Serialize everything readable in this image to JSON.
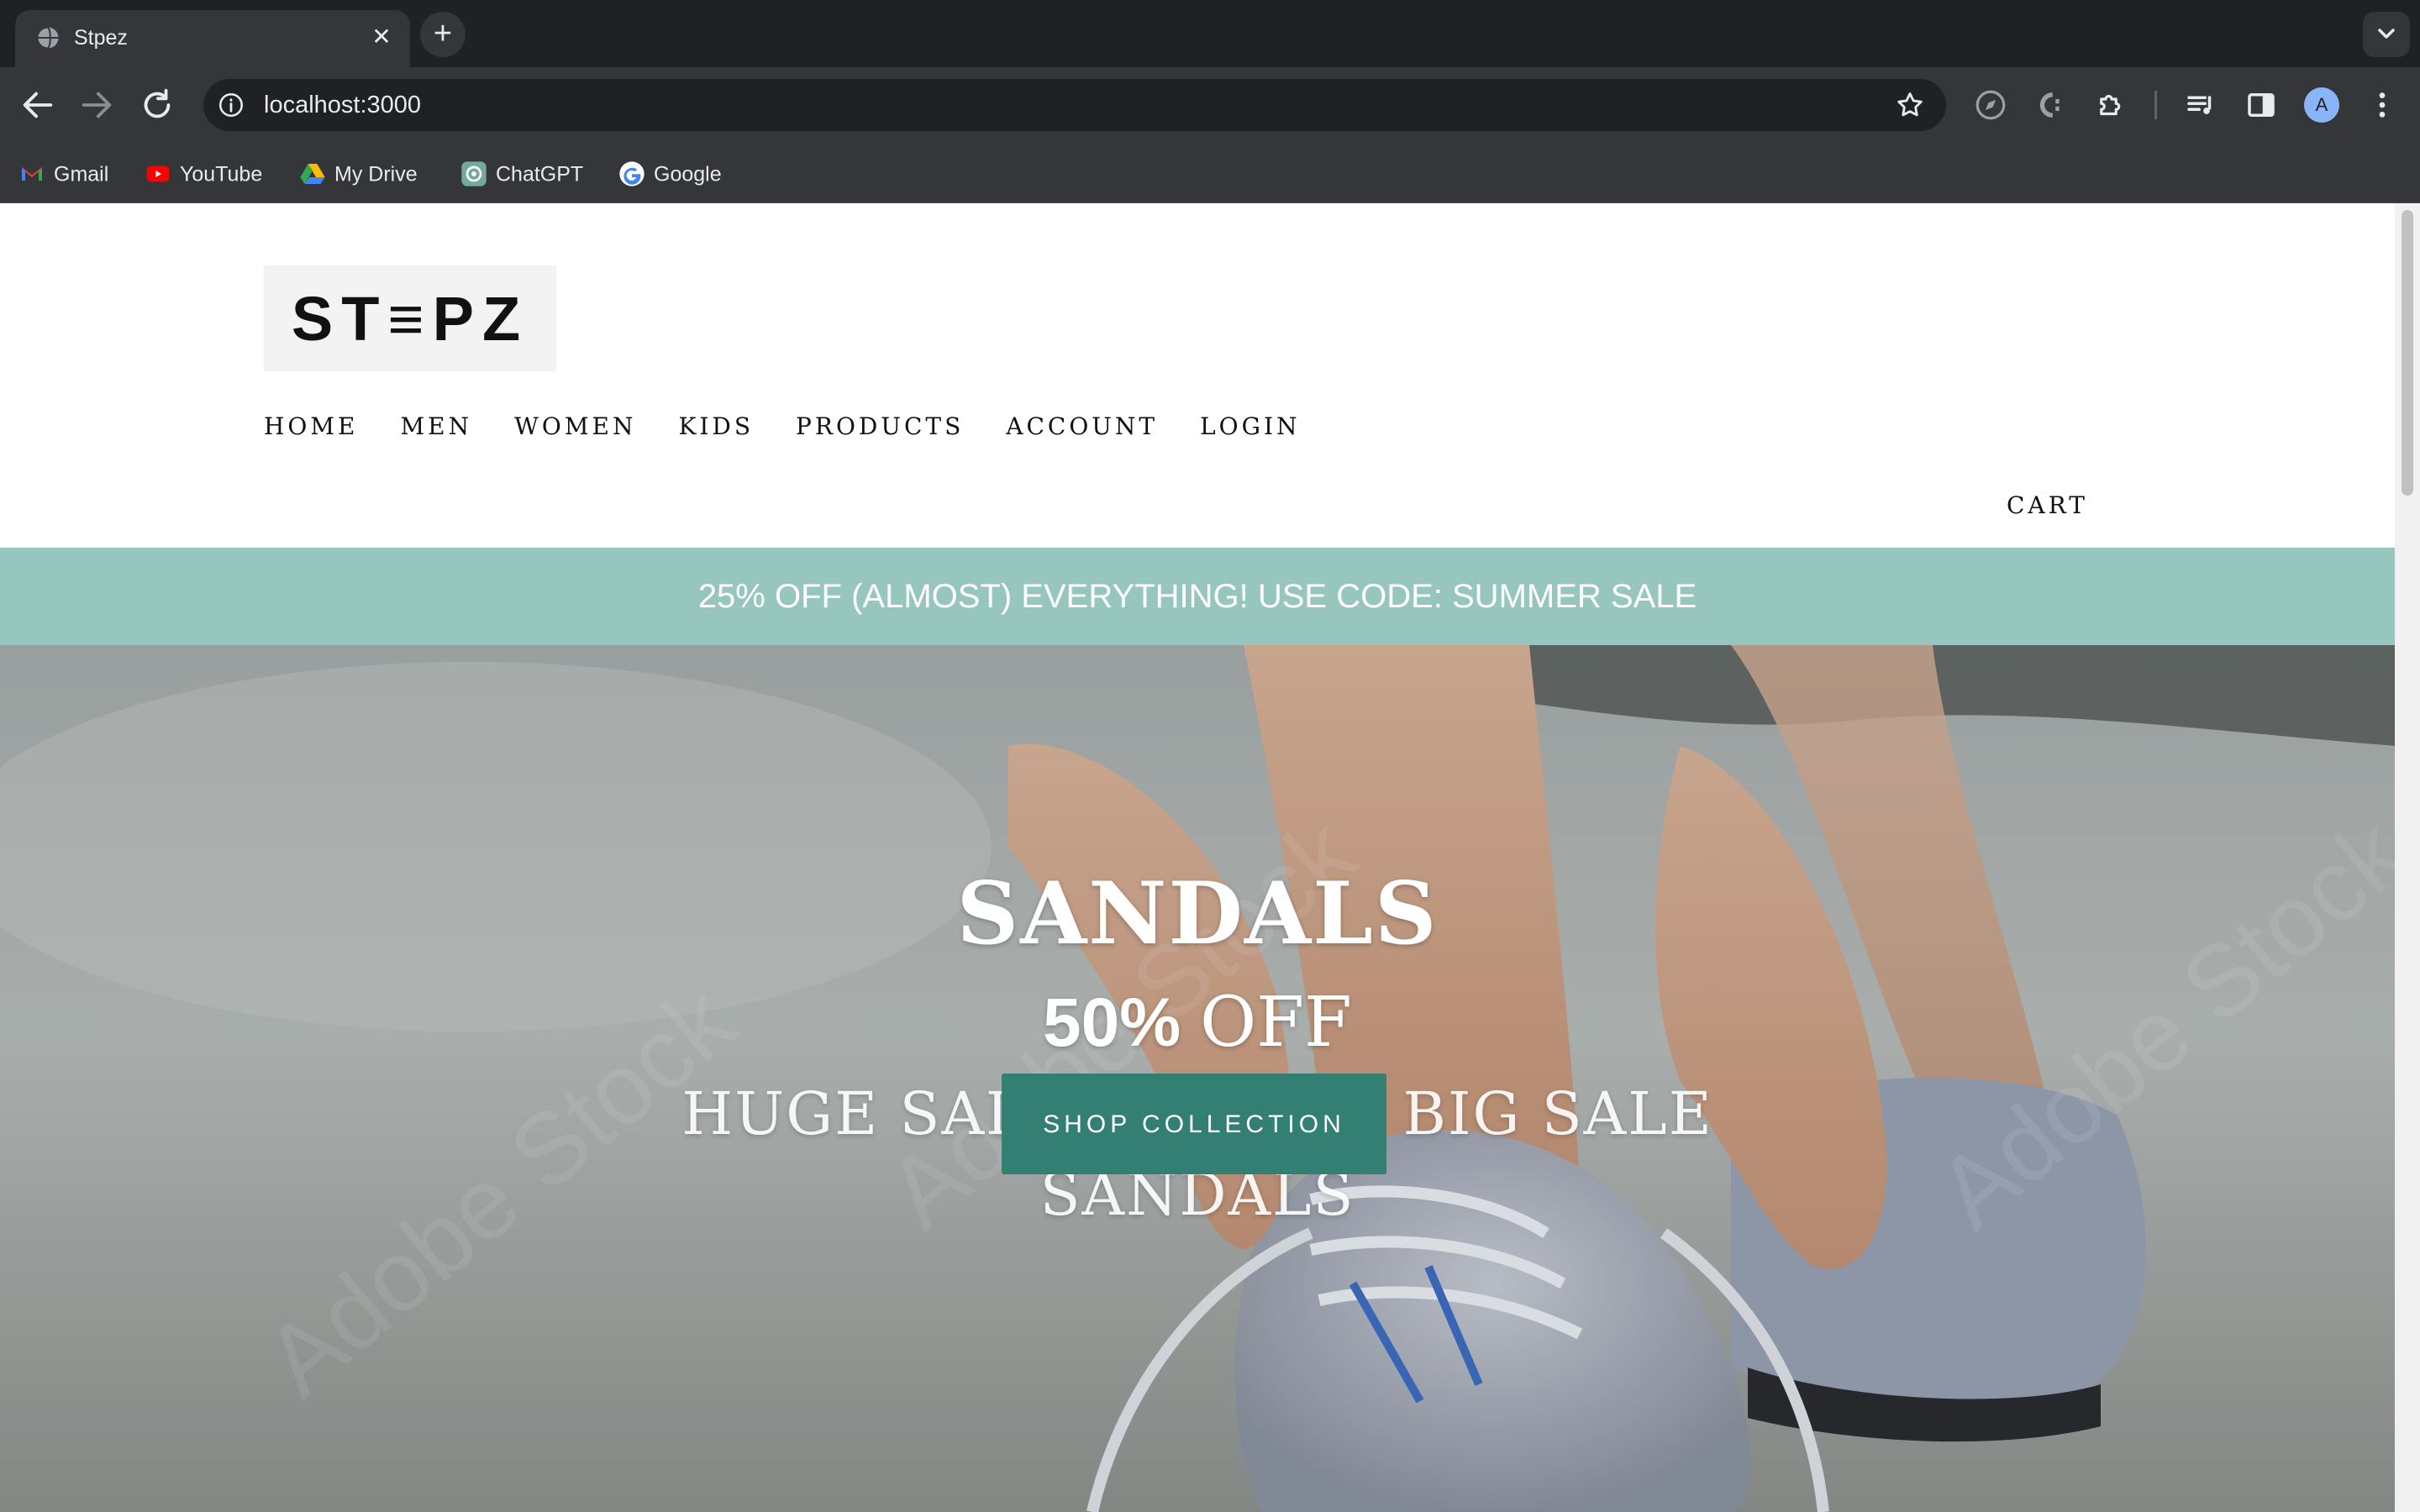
{
  "browser": {
    "tab": {
      "title": "Stpez",
      "close_glyph": "✕"
    },
    "new_tab_glyph": "+",
    "address": {
      "url": "localhost:3000"
    },
    "avatar_initial": "A",
    "bookmarks": [
      {
        "label": "Gmail",
        "icon": "gmail-icon"
      },
      {
        "label": "YouTube",
        "icon": "youtube-icon"
      },
      {
        "label": "My Drive",
        "icon": "google-drive-icon"
      },
      {
        "label": "ChatGPT",
        "icon": "chatgpt-icon"
      },
      {
        "label": "Google",
        "icon": "google-icon"
      }
    ],
    "toolbar_icons": [
      "back-icon",
      "forward-icon",
      "reload-icon",
      "info-icon",
      "star-icon",
      "compass-icon",
      "extension-c-icon",
      "puzzle-icon",
      "media-queue-icon",
      "side-panel-icon",
      "kebab-menu-icon"
    ]
  },
  "site": {
    "logo_text": "ST≡PZ",
    "nav": [
      "HOME",
      "MEN",
      "WOMEN",
      "KIDS",
      "PRODUCTS",
      "ACCOUNT",
      "LOGIN"
    ],
    "cart_label": "CART",
    "promo": "25% OFF (ALMOST) EVERYTHING! USE CODE: SUMMER SALE",
    "hero": {
      "title": "SANDALS",
      "discount_pct": "50%",
      "discount_word": "OFF",
      "subtitle": "HUGE SALE 50% OFF BIG SALE SANDALS",
      "cta": "SHOP COLLECTION"
    }
  },
  "colors": {
    "promo_bg": "#96c6bd",
    "cta_bg": "#347f74",
    "chrome_dark": "#202124",
    "chrome_mid": "#35363a"
  }
}
